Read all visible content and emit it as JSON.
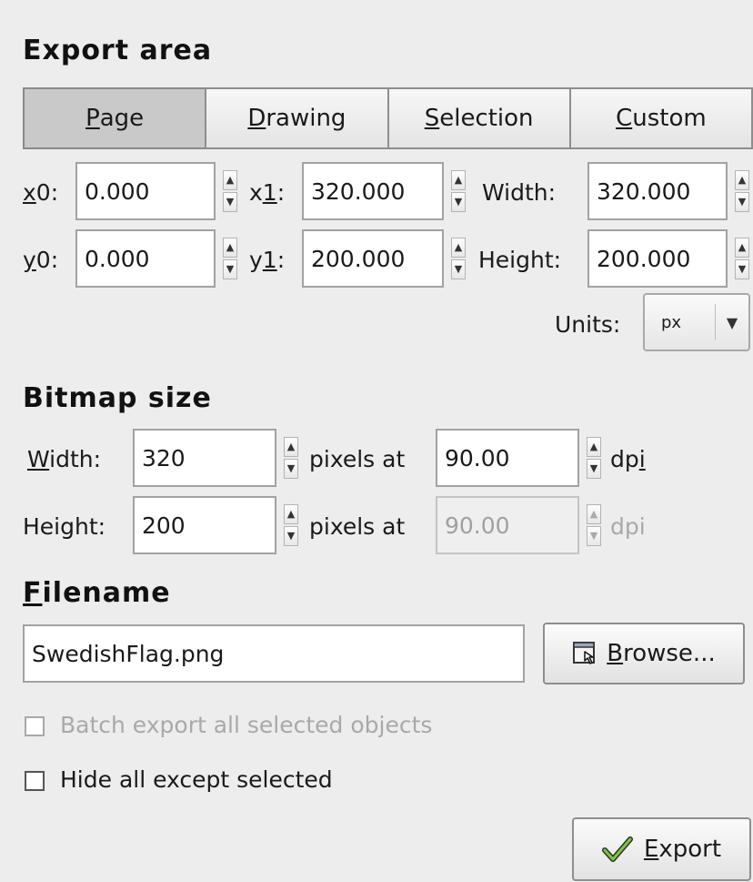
{
  "export_area": {
    "title": "Export area",
    "tabs": [
      {
        "mnemonic": "P",
        "rest": "age",
        "active": true
      },
      {
        "mnemonic": "D",
        "rest": "rawing",
        "active": false
      },
      {
        "mnemonic": "S",
        "rest": "election",
        "active": false
      },
      {
        "mnemonic": "C",
        "rest": "ustom",
        "active": false
      }
    ],
    "x0": {
      "label_m": "x",
      "label_rest": "0:",
      "value": "0.000"
    },
    "x1": {
      "label_a": "x",
      "label_m": "1",
      "label_rest": ":",
      "value": "320.000"
    },
    "width": {
      "label": "Width:",
      "value": "320.000"
    },
    "y0": {
      "label_m": "y",
      "label_rest": "0:",
      "value": "0.000"
    },
    "y1": {
      "label_a": "y",
      "label_m": "1",
      "label_rest": ":",
      "value": "200.000"
    },
    "height": {
      "label": "Height:",
      "value": "200.000"
    },
    "units": {
      "label": "Units:",
      "value": "px"
    }
  },
  "bitmap_size": {
    "title": "Bitmap size",
    "width": {
      "label_m": "W",
      "label_rest": "idth:",
      "value": "320",
      "pixels_at": "pixels at",
      "dpi": "90.00",
      "dpi_label_a": "dp",
      "dpi_label_m": "i"
    },
    "height": {
      "label": "Height:",
      "value": "200",
      "pixels_at": "pixels at",
      "dpi": "90.00",
      "dpi_label": "dpi"
    }
  },
  "filename": {
    "title_m": "F",
    "title_rest": "ilename",
    "value": "SwedishFlag.png",
    "browse_m": "B",
    "browse_rest": "rowse...",
    "browse_icon": "folder-browse-icon"
  },
  "options": {
    "batch": {
      "label": "Batch export all selected objects",
      "checked": false,
      "enabled": false
    },
    "hide": {
      "label": "Hide all except selected",
      "checked": false,
      "enabled": true
    }
  },
  "export_button": {
    "mnemonic": "E",
    "rest": "xport",
    "icon": "checkmark-icon"
  }
}
